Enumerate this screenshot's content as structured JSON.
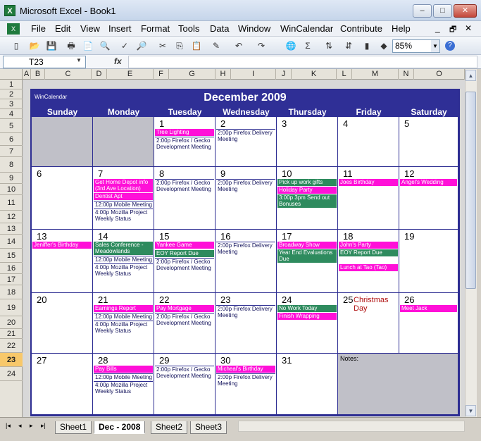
{
  "window": {
    "title": "Microsoft Excel - Book1",
    "app_icon": "X",
    "min": "–",
    "max": "□",
    "close": "✕"
  },
  "menu": [
    "File",
    "Edit",
    "View",
    "Insert",
    "Format",
    "Tools",
    "Data",
    "Window",
    "WinCalendar",
    "Contribute",
    "Help"
  ],
  "menu_right": {
    "min": "_",
    "restore": "🗗",
    "close": "✕"
  },
  "toolbar": {
    "zoom": "85%",
    "icons": [
      "new-icon",
      "open-icon",
      "save-icon",
      "print-icon",
      "print-preview-icon",
      "spelling-icon",
      "cut-icon",
      "copy-icon",
      "paste-icon",
      "format-painter-icon",
      "undo-icon",
      "redo-icon",
      "hyperlink-icon",
      "autosum-icon",
      "sort-asc-icon",
      "sort-desc-icon",
      "chart-wizard-icon",
      "drawing-icon",
      "help-icon"
    ]
  },
  "formula": {
    "name_box": "T23",
    "fx": "fx",
    "value": ""
  },
  "columns": [
    "A",
    "B",
    "C",
    "D",
    "E",
    "F",
    "G",
    "H",
    "I",
    "J",
    "K",
    "L",
    "M",
    "N",
    "O"
  ],
  "rows": [
    "1",
    "2",
    "3",
    "4",
    "5",
    "6",
    "7",
    "8",
    "9",
    "10",
    "11",
    "12",
    "13",
    "14",
    "15",
    "16",
    "17",
    "18",
    "19",
    "20",
    "21",
    "22",
    "23",
    "24"
  ],
  "tabs": {
    "nav": [
      "|◂",
      "◂",
      "▸",
      "▸|"
    ],
    "sheets": [
      "Sheet1",
      "Dec - 2008",
      "Sheet2",
      "Sheet3"
    ],
    "active": 1
  },
  "calendar": {
    "brand": "WinCalendar",
    "title": "December 2009",
    "days": [
      "Sunday",
      "Monday",
      "Tuesday",
      "Wednesday",
      "Thursday",
      "Friday",
      "Saturday"
    ],
    "notes": "Notes:",
    "holiday": "Christmas Day",
    "weeks": [
      [
        null,
        null,
        {
          "d": "1",
          "ev": [
            {
              "t": "Tree Lighting",
              "c": "pink"
            },
            {
              "t": "2:00p Firefox / Gecko Development Meeting",
              "c": "plain"
            }
          ]
        },
        {
          "d": "2",
          "ev": [
            {
              "t": "2:00p Firefox Delivery Meeting",
              "c": "plain"
            }
          ]
        },
        {
          "d": "3",
          "ev": []
        },
        {
          "d": "4",
          "ev": []
        },
        {
          "d": "5",
          "ev": []
        }
      ],
      [
        {
          "d": "6",
          "ev": []
        },
        {
          "d": "7",
          "ev": [
            {
              "t": "Get Home Depot info (3rd Ave Location)",
              "c": "pink"
            },
            {
              "t": "Dentist Apt",
              "c": "pink"
            },
            {
              "t": "12:00p Mobile Meeting",
              "c": "plain"
            },
            {
              "t": "4:00p Mozilla Project Weekly Status",
              "c": "plain"
            }
          ]
        },
        {
          "d": "8",
          "ev": [
            {
              "t": "2:00p Firefox / Gecko Development Meeting",
              "c": "plain"
            }
          ]
        },
        {
          "d": "9",
          "ev": [
            {
              "t": "2:00p Firefox Delivery Meeting",
              "c": "plain"
            }
          ]
        },
        {
          "d": "10",
          "ev": [
            {
              "t": "Pick up work gifts",
              "c": "green"
            },
            {
              "t": "Holiday Party",
              "c": "pink"
            },
            {
              "t": "3:00p 3pm Send out Bonuses",
              "c": "green"
            }
          ]
        },
        {
          "d": "11",
          "ev": [
            {
              "t": "Joes Birthday",
              "c": "pink"
            }
          ]
        },
        {
          "d": "12",
          "ev": [
            {
              "t": "Angel's Wedding",
              "c": "pink"
            }
          ]
        }
      ],
      [
        {
          "d": "13",
          "ev": [
            {
              "t": "Jeniffer's Birthday",
              "c": "pink"
            }
          ]
        },
        {
          "d": "14",
          "ev": [
            {
              "t": "Sales Conference - Meadowlands",
              "c": "green"
            },
            {
              "t": "12:00p Mobile Meeting",
              "c": "plain"
            },
            {
              "t": "4:00p Mozilla Project Weekly Status",
              "c": "plain"
            }
          ]
        },
        {
          "d": "15",
          "ev": [
            {
              "t": "Yankee Game",
              "c": "pink"
            },
            {
              "t": "EOY Report Due",
              "c": "green"
            },
            {
              "t": "2:00p Firefox / Gecko Development Meeting",
              "c": "plain"
            }
          ]
        },
        {
          "d": "16",
          "ev": [
            {
              "t": "2:00p Firefox Delivery Meeting",
              "c": "plain"
            }
          ]
        },
        {
          "d": "17",
          "ev": [
            {
              "t": "Broadway Show",
              "c": "pink"
            },
            {
              "t": "Year End Evaluations Due",
              "c": "green"
            }
          ]
        },
        {
          "d": "18",
          "ev": [
            {
              "t": "John's Party",
              "c": "pink"
            },
            {
              "t": "EOY Report Due",
              "c": "green"
            },
            {
              "t": "Lunch at Tao (Tao)",
              "c": "pink"
            }
          ]
        },
        {
          "d": "19",
          "ev": []
        }
      ],
      [
        {
          "d": "20",
          "ev": []
        },
        {
          "d": "21",
          "ev": [
            {
              "t": "Earnings Report",
              "c": "pink"
            },
            {
              "t": "12:00p Mobile Meeting",
              "c": "plain"
            },
            {
              "t": "4:00p Mozilla Project Weekly Status",
              "c": "plain"
            }
          ]
        },
        {
          "d": "22",
          "ev": [
            {
              "t": "Pay Mortgage",
              "c": "pink"
            },
            {
              "t": "2:00p Firefox / Gecko Development Meeting",
              "c": "plain"
            }
          ]
        },
        {
          "d": "23",
          "ev": [
            {
              "t": "2:00p Firefox Delivery Meeting",
              "c": "plain"
            }
          ]
        },
        {
          "d": "24",
          "ev": [
            {
              "t": "No Work Today",
              "c": "green"
            },
            {
              "t": "Finish Wrapping",
              "c": "pink"
            }
          ]
        },
        {
          "d": "25",
          "ev": [],
          "hol": true
        },
        {
          "d": "26",
          "ev": [
            {
              "t": "Meet Jack",
              "c": "pink"
            }
          ]
        }
      ],
      [
        {
          "d": "27",
          "ev": []
        },
        {
          "d": "28",
          "ev": [
            {
              "t": "Pay Bills",
              "c": "pink"
            },
            {
              "t": "12:00p Mobile Meeting",
              "c": "plain"
            },
            {
              "t": "4:00p Mozilla Project Weekly Status",
              "c": "plain"
            }
          ]
        },
        {
          "d": "29",
          "ev": [
            {
              "t": "2:00p Firefox / Gecko Development Meeting",
              "c": "plain"
            }
          ]
        },
        {
          "d": "30",
          "ev": [
            {
              "t": "Micheal's Birthday",
              "c": "pink"
            },
            {
              "t": "2:00p Firefox Delivery Meeting",
              "c": "plain"
            }
          ]
        },
        {
          "d": "31",
          "ev": []
        },
        "notes",
        null
      ]
    ]
  }
}
